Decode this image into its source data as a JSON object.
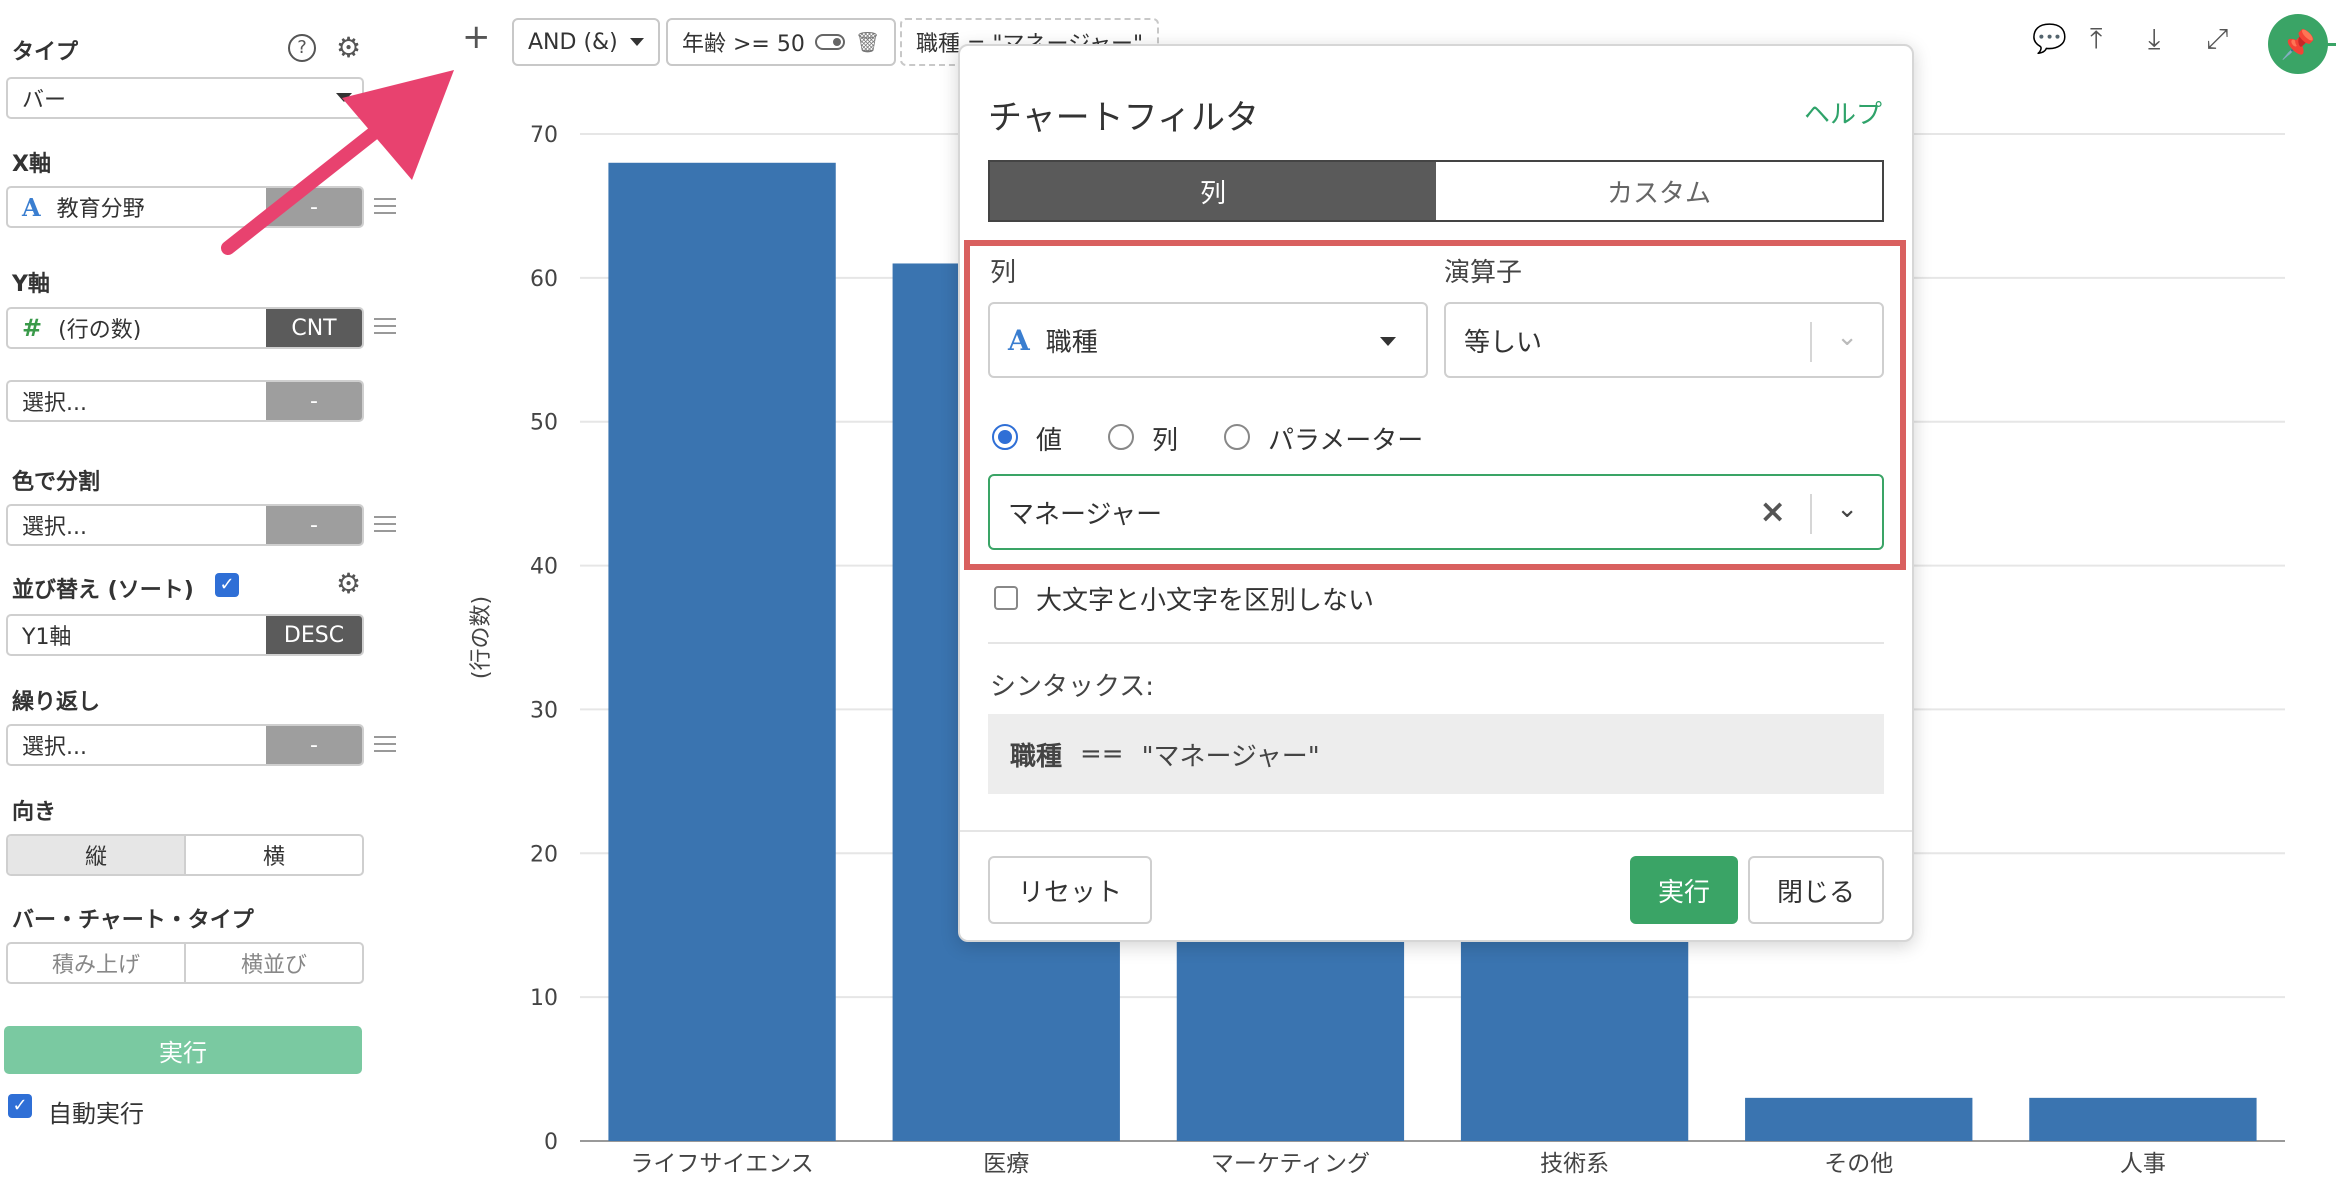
{
  "sidebar": {
    "type_label": "タイプ",
    "type_value": "バー",
    "x_axis_label": "X軸",
    "x_field": "教育分野",
    "x_agg": "-",
    "y_axis_label": "Y軸",
    "y_field": "(行の数)",
    "y_agg": "CNT",
    "y2_placeholder": "選択...",
    "y2_agg": "-",
    "color_label": "色で分割",
    "color_placeholder": "選択...",
    "color_agg": "-",
    "sort_label": "並び替え (ソート)",
    "sort_field": "Y1軸",
    "sort_order": "DESC",
    "repeat_label": "繰り返し",
    "repeat_placeholder": "選択...",
    "repeat_agg": "-",
    "orientation_label": "向き",
    "orientation_vertical": "縦",
    "orientation_horizontal": "横",
    "bar_type_label": "バー・チャート・タイプ",
    "bar_type_stacked": "積み上げ",
    "bar_type_side": "横並び",
    "run_label": "実行",
    "auto_run_label": "自動実行"
  },
  "toolbar": {
    "plus": "+",
    "logic": "AND (&)",
    "filter1": "年齢 >= 50",
    "filter2": "職種 = \"マネージャー\""
  },
  "chart_data": {
    "type": "bar",
    "categories": [
      "ライフサイエンス",
      "医療",
      "マーケティング",
      "技術系",
      "その他",
      "人事"
    ],
    "values": [
      68,
      61,
      45,
      40,
      3,
      3
    ],
    "ylabel": "(行の数)",
    "ylim": [
      0,
      70
    ],
    "yticks": [
      0,
      10,
      20,
      30,
      40,
      50,
      60,
      70
    ],
    "color": "#3a74b0",
    "grid": true
  },
  "dialog": {
    "title": "チャートフィルタ",
    "help": "ヘルプ",
    "tab_column": "列",
    "tab_custom": "カスタム",
    "column_label": "列",
    "column_value": "職種",
    "operator_label": "演算子",
    "operator_value": "等しい",
    "radio_value": "値",
    "radio_column": "列",
    "radio_parameter": "パラメーター",
    "value_input": "マネージャー",
    "case_insensitive": "大文字と小文字を区別しない",
    "syntax_label": "シンタックス:",
    "syntax_column": "職種",
    "syntax_op": "==",
    "syntax_value": "\"マネージャー\"",
    "reset": "リセット",
    "run": "実行",
    "close": "閉じる"
  },
  "colors": {
    "accent_green": "#3aa466",
    "highlight_red": "#d9605f",
    "bar_blue": "#3a74b0",
    "arrow_pink": "#e8426f"
  }
}
